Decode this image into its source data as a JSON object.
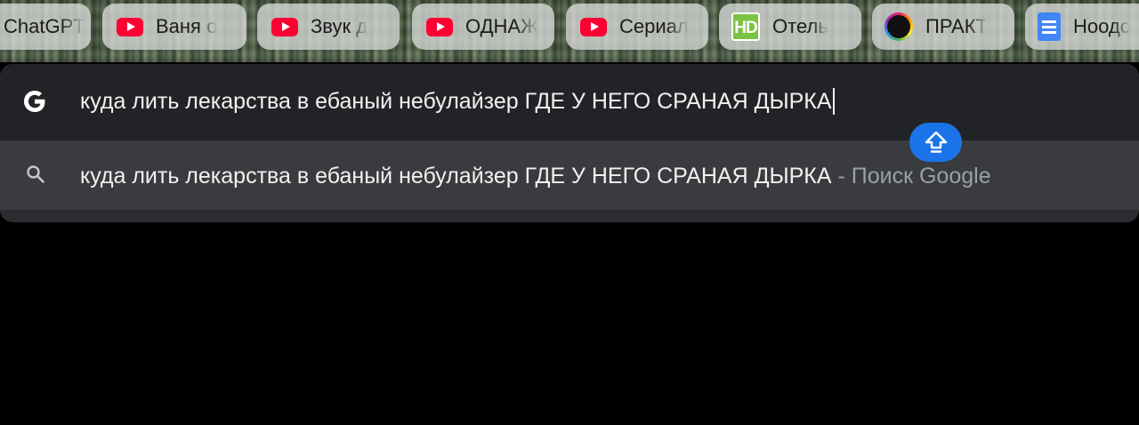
{
  "bookmarks": [
    {
      "label": "ChatGPT",
      "icon": "none"
    },
    {
      "label": "Ваня о",
      "icon": "youtube-icon"
    },
    {
      "label": "Звук д",
      "icon": "youtube-icon"
    },
    {
      "label": "ОДНАЖ",
      "icon": "youtube-icon"
    },
    {
      "label": "Сериал",
      "icon": "youtube-icon"
    },
    {
      "label": "Отель",
      "icon": "hd-icon"
    },
    {
      "label": "ПРАКТ",
      "icon": "creative-icon"
    },
    {
      "label": "Ноодс",
      "icon": "google-docs-icon"
    }
  ],
  "omnibox": {
    "input_value": "куда лить лекарства в ебаный небулайзер ГДЕ У НЕГО СРАНАЯ ДЫРКА",
    "suggestion": {
      "query": "куда лить лекарства в ебаный небулайзер ГДЕ У НЕГО СРАНАЯ ДЫРКА",
      "separator": " - ",
      "hint": "Поиск Google"
    }
  },
  "colors": {
    "omnibox_bg": "#222326",
    "suggestion_bg": "#3a3b3e",
    "accent": "#1a73e8",
    "youtube_red": "#ff0033"
  }
}
